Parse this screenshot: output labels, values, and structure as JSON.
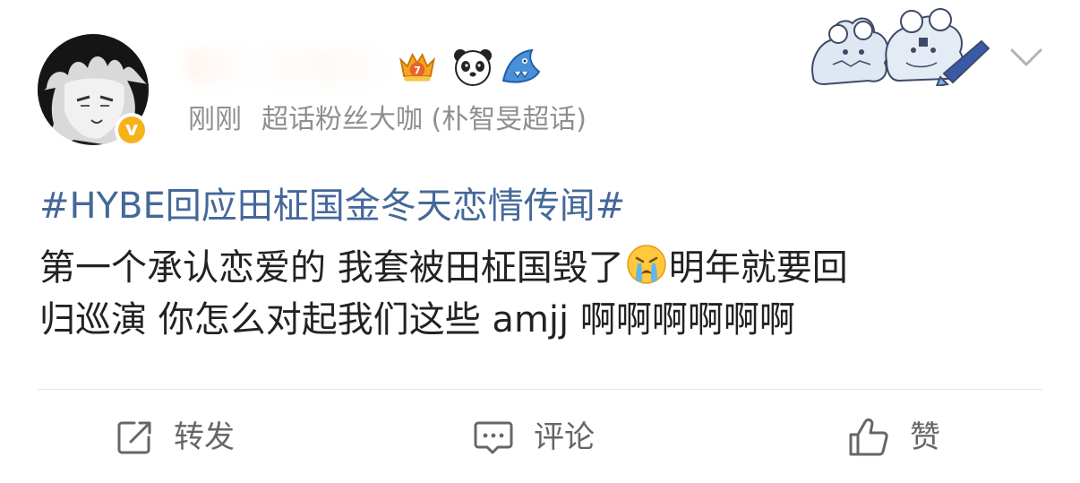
{
  "post": {
    "username": "",
    "timestamp": "刚刚",
    "source": "超话粉丝大咖 (朴智旻超话)",
    "topic": "#HYBE回应田柾国金冬天恋情传闻#",
    "text_line1_a": "第一个承认恋爱的 我套被田柾国毁了",
    "text_line1_b": "明年就要回",
    "text_line2": "归巡演 你怎么对起我们这些 amjj 啊啊啊啊啊啊"
  },
  "badges": {
    "level_icon": "crown-level-badge-icon",
    "panda_icon": "panda-icon",
    "shark_icon": "shark-icon",
    "verified_icon": "verified-v-icon"
  },
  "actions": {
    "repost_label": "转发",
    "comment_label": "评论",
    "like_label": "赞"
  },
  "colors": {
    "topic_link": "#45689a",
    "meta_gray": "#8f8f8f",
    "action_gray": "#666666",
    "verified_gold": "#f6b21a",
    "divider": "#e6e6e6"
  }
}
